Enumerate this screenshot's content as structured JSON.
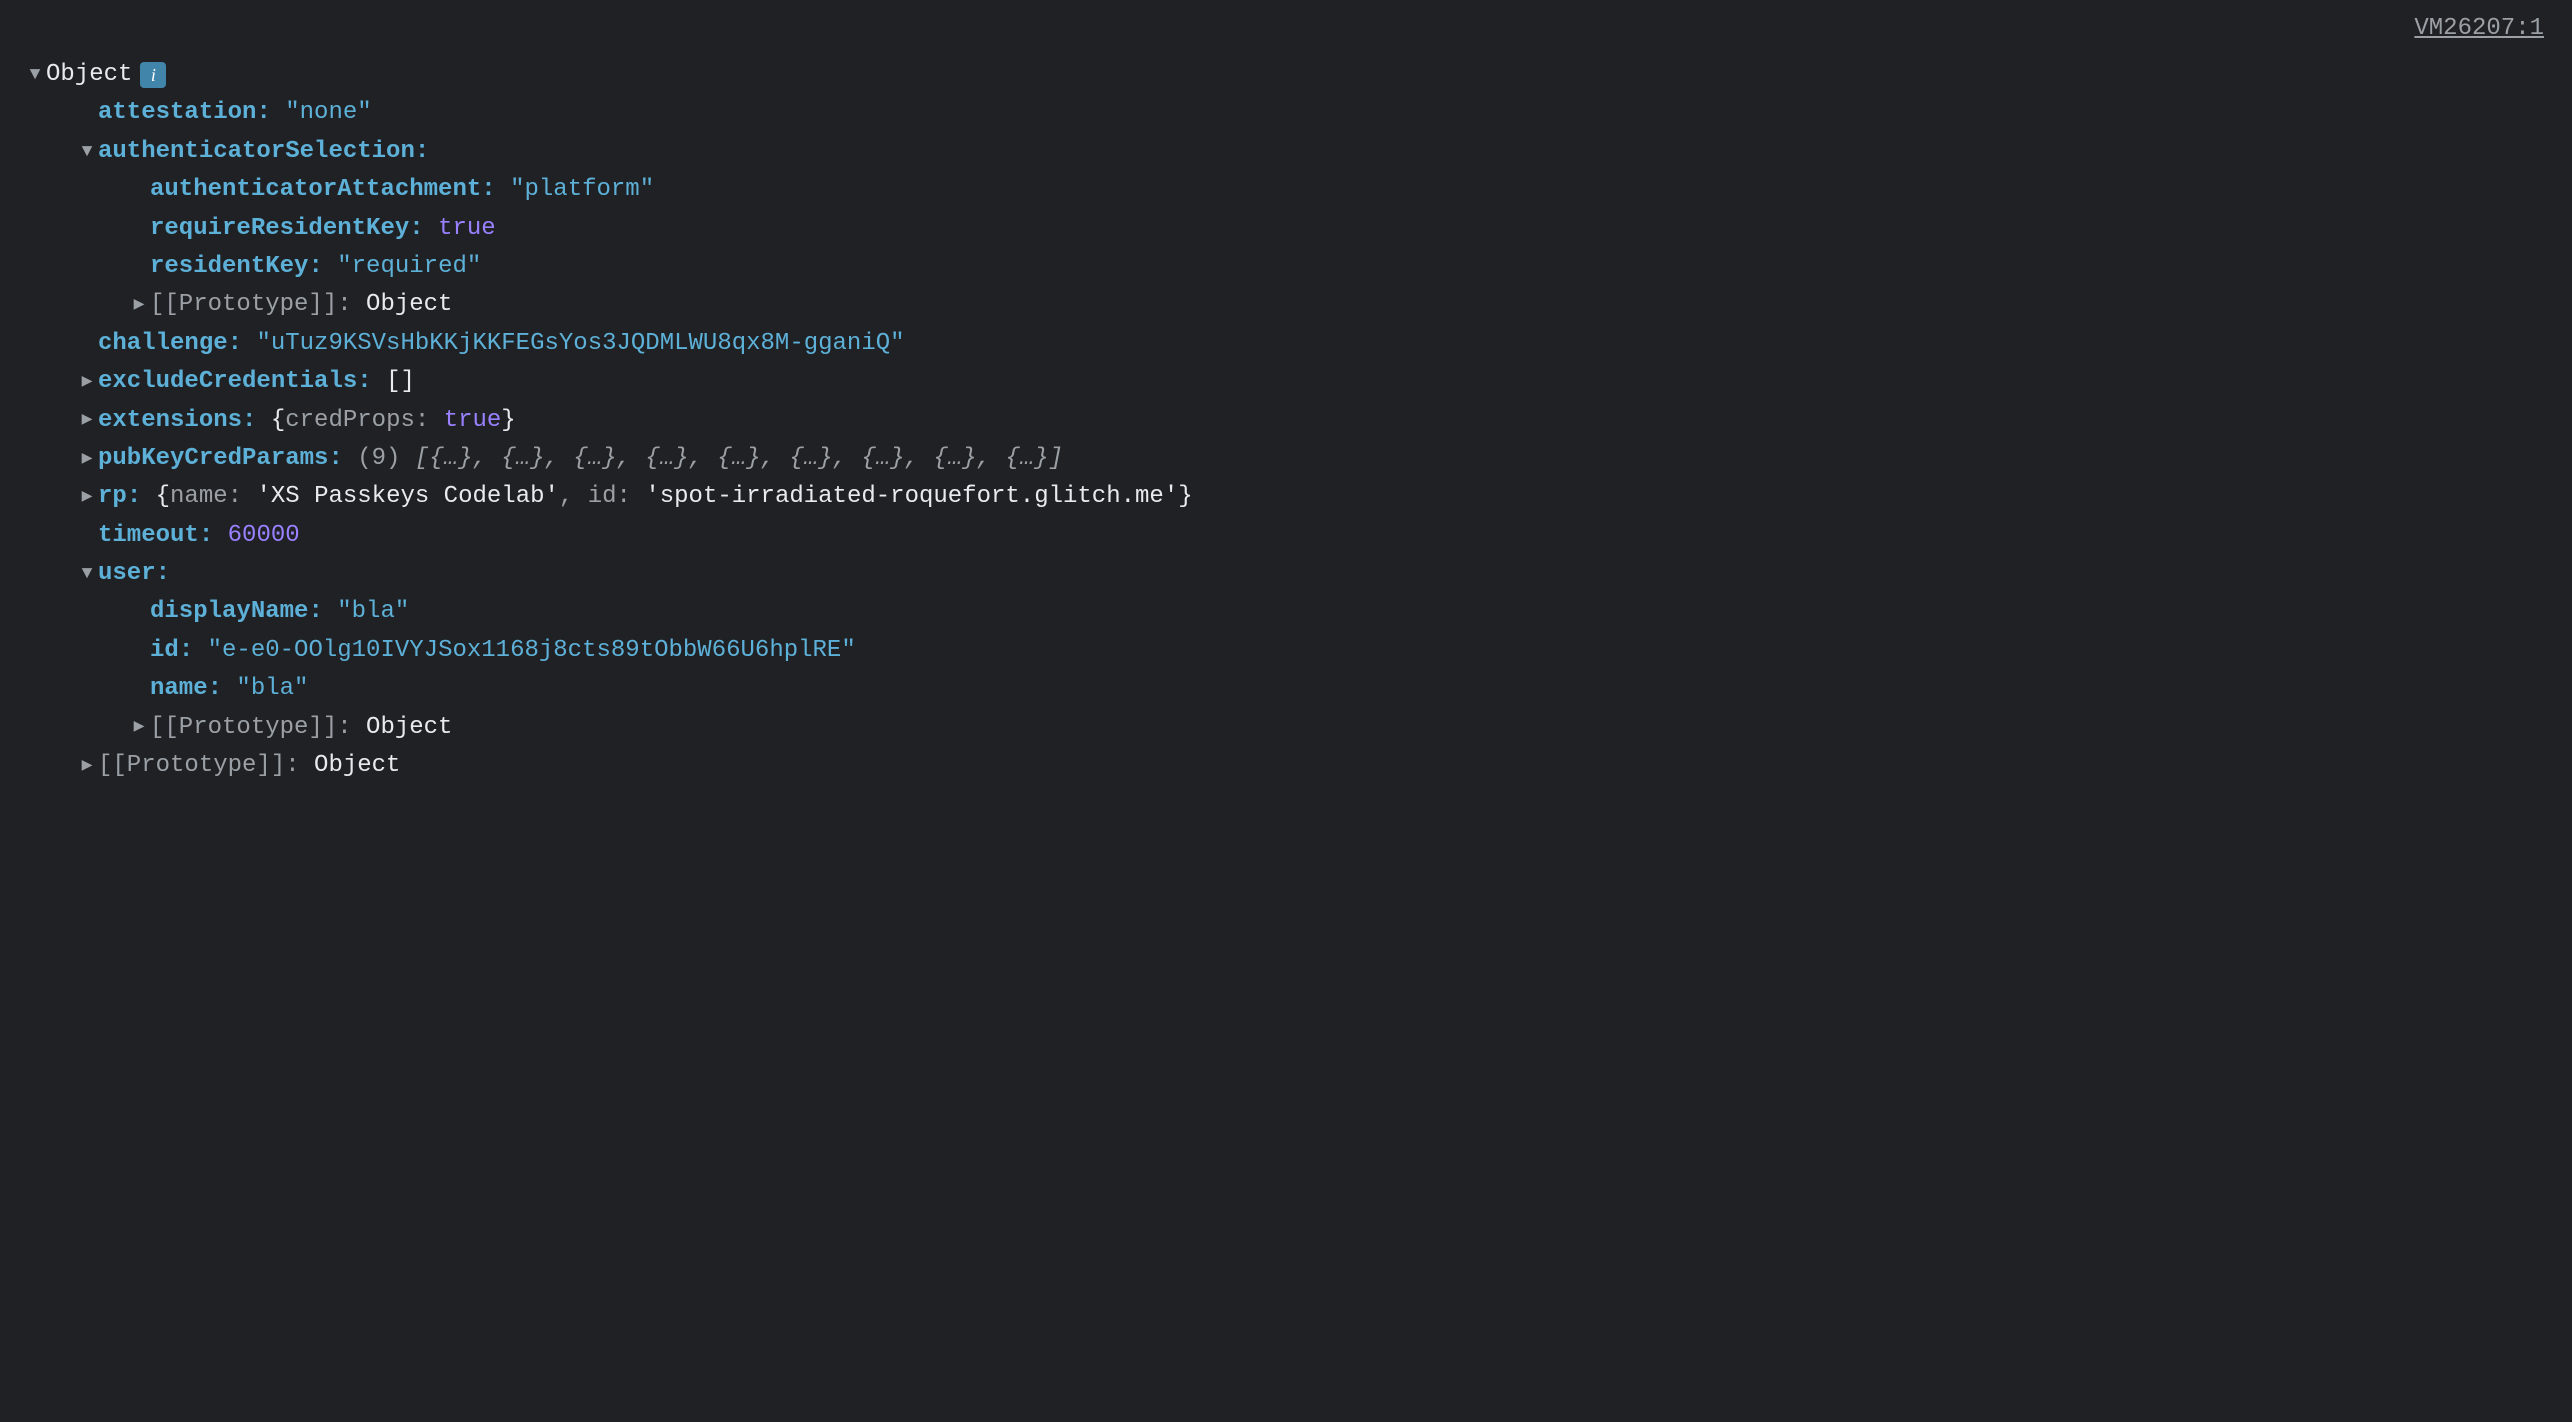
{
  "source_link": "VM26207:1",
  "root_label": "Object",
  "info_glyph": "i",
  "props": {
    "attestation": {
      "key": "attestation",
      "value": "\"none\""
    },
    "authenticatorSelection": {
      "key": "authenticatorSelection",
      "children": {
        "authenticatorAttachment": {
          "key": "authenticatorAttachment",
          "value": "\"platform\""
        },
        "requireResidentKey": {
          "key": "requireResidentKey",
          "value": "true"
        },
        "residentKey": {
          "key": "residentKey",
          "value": "\"required\""
        },
        "prototype": {
          "key": "[[Prototype]]",
          "value": "Object"
        }
      }
    },
    "challenge": {
      "key": "challenge",
      "value": "\"uTuz9KSVsHbKKjKKFEGsYos3JQDMLWU8qx8M-gganiQ\""
    },
    "excludeCredentials": {
      "key": "excludeCredentials",
      "value": "[]"
    },
    "extensions": {
      "key": "extensions",
      "preview_open": "{",
      "preview_key": "credProps: ",
      "preview_val": "true",
      "preview_close": "}"
    },
    "pubKeyCredParams": {
      "key": "pubKeyCredParams",
      "count": "(9) ",
      "value": "[{…}, {…}, {…}, {…}, {…}, {…}, {…}, {…}, {…}]"
    },
    "rp": {
      "key": "rp",
      "preview_open": "{",
      "name_key": "name: ",
      "name_val": "'XS Passkeys Codelab'",
      "sep": ", ",
      "id_key": "id: ",
      "id_val": "'spot-irradiated-roquefort.glitch.me'",
      "preview_close": "}"
    },
    "timeout": {
      "key": "timeout",
      "value": "60000"
    },
    "user": {
      "key": "user",
      "children": {
        "displayName": {
          "key": "displayName",
          "value": "\"bla\""
        },
        "id": {
          "key": "id",
          "value": "\"e-e0-OOlg10IVYJSox1168j8cts89tObbW66U6hplRE\""
        },
        "name": {
          "key": "name",
          "value": "\"bla\""
        },
        "prototype": {
          "key": "[[Prototype]]",
          "value": "Object"
        }
      }
    },
    "prototype": {
      "key": "[[Prototype]]",
      "value": "Object"
    }
  },
  "glyphs": {
    "down": "▼",
    "right": "▶"
  }
}
